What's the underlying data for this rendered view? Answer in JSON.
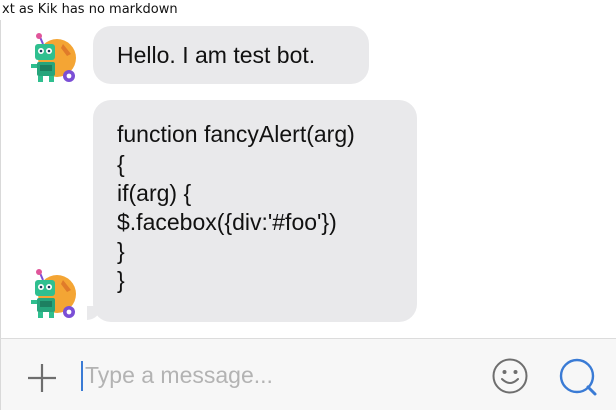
{
  "caption": "xt as Kik has no markdown",
  "messages": [
    {
      "sender_icon": "robot-avatar-icon",
      "text": "Hello. I am test bot."
    },
    {
      "sender_icon": "robot-avatar-icon",
      "lines": [
        "function fancyAlert(arg)",
        "{",
        "if(arg) {",
        "$.facebox({div:'#foo'})",
        "}",
        "}"
      ]
    }
  ],
  "input_bar": {
    "add_icon": "plus-icon",
    "placeholder": "Type a message...",
    "emoji_icon": "smiley-icon",
    "search_icon": "search-icon"
  },
  "colors": {
    "bubble": "#e9e9eb",
    "accent": "#3a7bd5",
    "input_bar": "#f7f7f7",
    "avatar_green": "#2fbf8f",
    "avatar_orange": "#f4a534",
    "badge_purple": "#7b4fd6"
  }
}
